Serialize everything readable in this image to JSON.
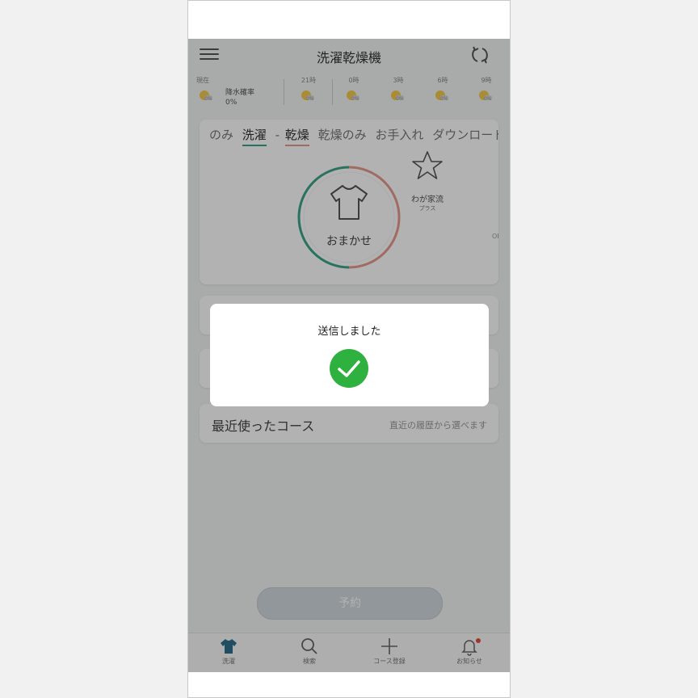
{
  "app": {
    "title": "洗濯乾燥機"
  },
  "weather": {
    "now_label": "現在",
    "precip_label": "降水確率",
    "precip_value": "0%",
    "hours": [
      "21時",
      "0時",
      "3時",
      "6時",
      "9時"
    ],
    "percent": "0%"
  },
  "program": {
    "tabs": [
      {
        "label": "のみ",
        "state": "partial"
      },
      {
        "label": "洗濯",
        "state": "active-wash"
      },
      {
        "label": "-",
        "state": "separator"
      },
      {
        "label": "乾燥",
        "state": "active-dry"
      },
      {
        "label": "乾燥のみ",
        "state": "normal"
      },
      {
        "label": "お手入れ",
        "state": "normal"
      },
      {
        "label": "ダウンロード",
        "state": "normal"
      }
    ],
    "dial_label": "おまかせ",
    "favorite_label": "わが家流",
    "favorite_sub": "プラス",
    "edge_fragment": "OF"
  },
  "recent": {
    "title": "最近使ったコース",
    "hint": "直近の履歴から選べます"
  },
  "reserve_button": "予約",
  "nav": {
    "items": [
      {
        "label": "洗濯",
        "icon": "shirt-icon"
      },
      {
        "label": "検索",
        "icon": "search-icon"
      },
      {
        "label": "コース登録",
        "icon": "plus-icon"
      },
      {
        "label": "お知らせ",
        "icon": "bell-icon"
      }
    ]
  },
  "modal": {
    "message": "送信しました",
    "icon": "check-icon",
    "icon_color": "#2fb13f"
  },
  "colors": {
    "wash_accent": "#3aa488",
    "dry_accent": "#e59a8e",
    "notification_dot": "#e74c3c"
  }
}
